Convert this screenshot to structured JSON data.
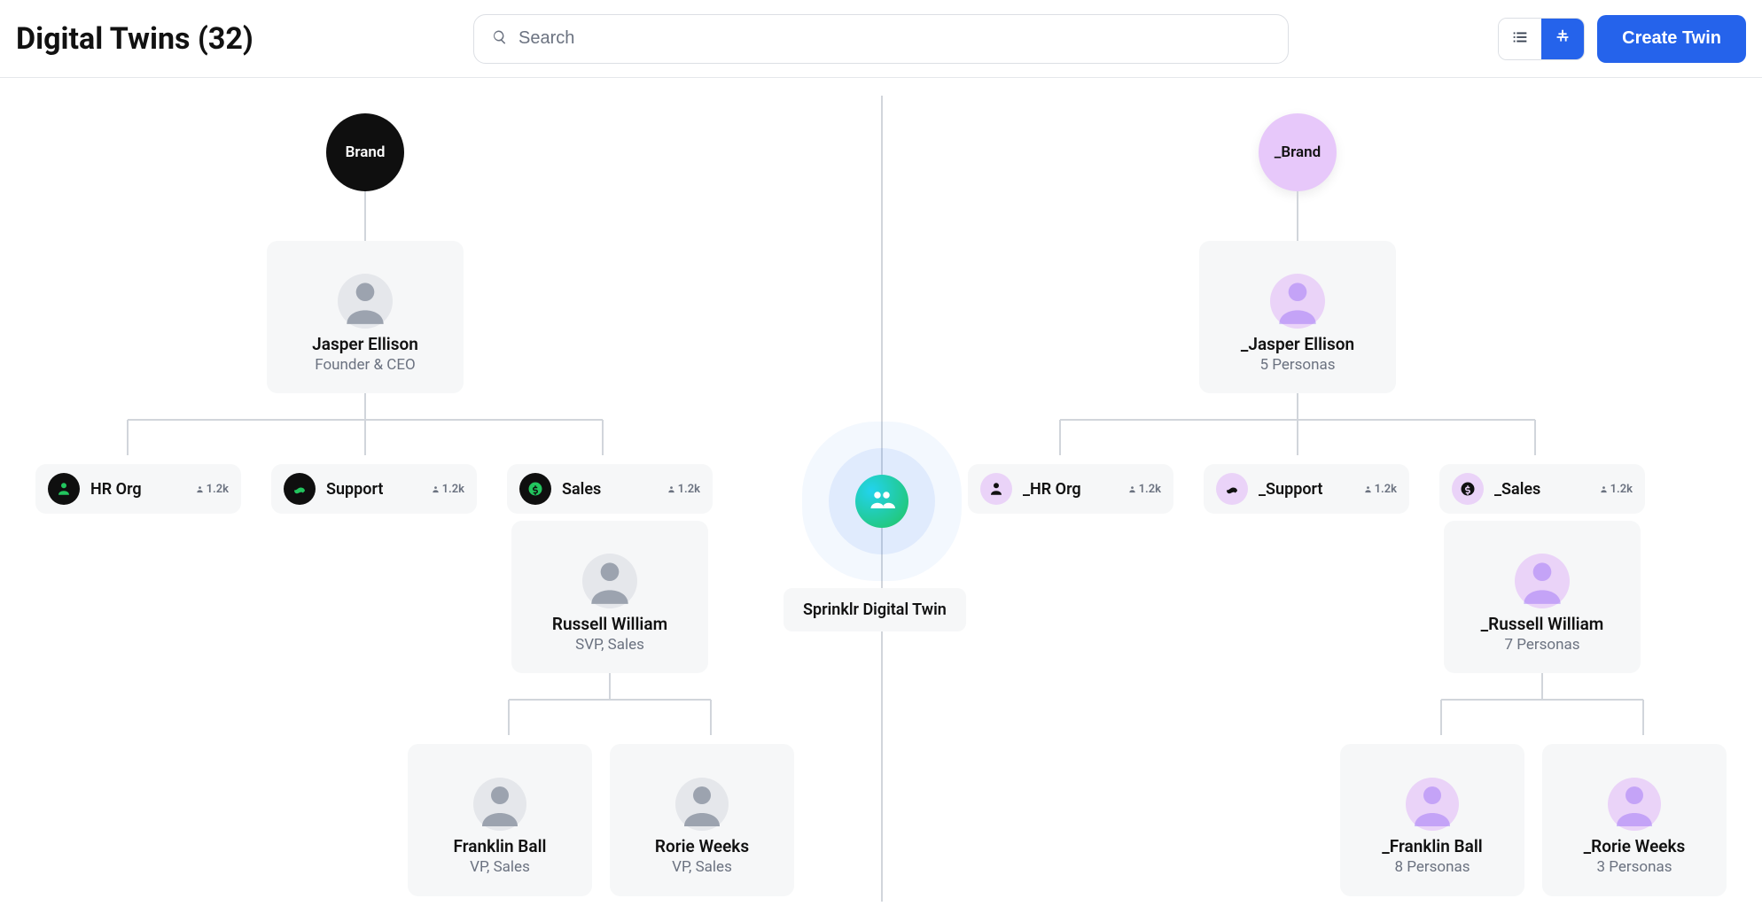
{
  "header": {
    "title_prefix": "Digital Twins",
    "count": "(32)",
    "search_placeholder": "Search",
    "create_label": "Create Twin"
  },
  "center": {
    "label": "Sprinklr Digital Twin"
  },
  "left": {
    "root": "Brand",
    "ceo": {
      "name": "Jasper Ellison",
      "sub": "Founder & CEO"
    },
    "departments": [
      {
        "label": "HR Org",
        "stat": "1.2k",
        "icon": "hr",
        "color": "#0f0f0f"
      },
      {
        "label": "Support",
        "stat": "1.2k",
        "icon": "support",
        "color": "#0f0f0f"
      },
      {
        "label": "Sales",
        "stat": "1.2k",
        "icon": "sales",
        "color": "#0f0f0f"
      }
    ],
    "svp": {
      "name": "Russell William",
      "sub": "SVP, Sales"
    },
    "children": [
      {
        "name": "Franklin Ball",
        "sub": "VP, Sales"
      },
      {
        "name": "Rorie Weeks",
        "sub": "VP, Sales"
      }
    ]
  },
  "right": {
    "root": "_Brand",
    "ceo": {
      "name": "_Jasper Ellison",
      "sub": "5 Personas"
    },
    "departments": [
      {
        "label": "_HR Org",
        "stat": "1.2k",
        "icon": "hr"
      },
      {
        "label": "_Support",
        "stat": "1.2k",
        "icon": "support"
      },
      {
        "label": "_Sales",
        "stat": "1.2k",
        "icon": "sales"
      }
    ],
    "svp": {
      "name": "_Russell William",
      "sub": "7 Personas"
    },
    "children": [
      {
        "name": "_Franklin Ball",
        "sub": "8 Personas"
      },
      {
        "name": "_Rorie Weeks",
        "sub": "3 Personas"
      }
    ]
  }
}
